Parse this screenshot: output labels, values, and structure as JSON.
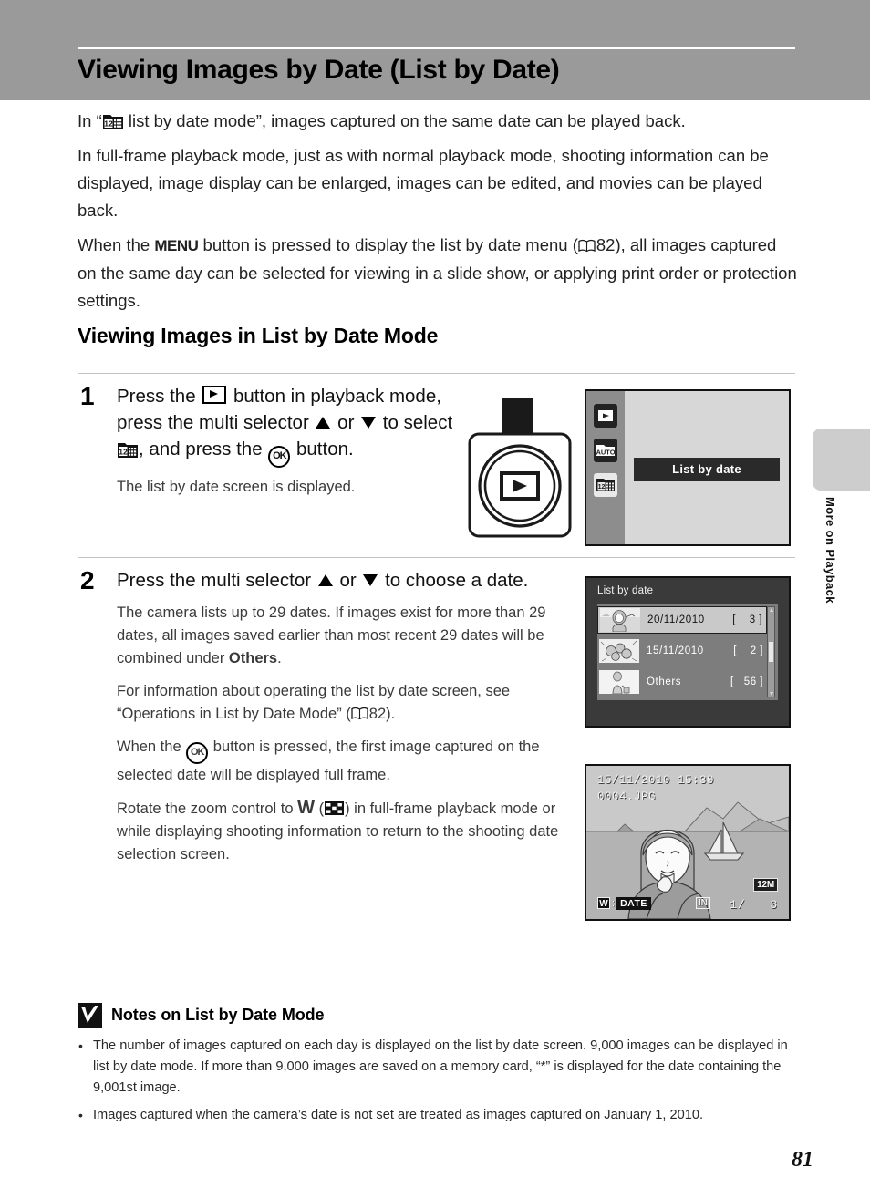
{
  "page": {
    "title": "Viewing Images by Date (List by Date)",
    "number": "81",
    "side_tab_label": "More on Playback",
    "header_color": "#9a9a9a"
  },
  "intro": {
    "p1_pre": "In “",
    "p1_post": " list by date mode”, images captured on the same date can be played back.",
    "p2": "In full-frame playback mode, just as with normal playback mode, shooting information can be displayed, image display can be enlarged, images can be edited, and movies can be played back.",
    "p3_a": "When the ",
    "p3_menu": "MENU",
    "p3_b": " button is pressed to display the list by date menu (",
    "p3_page": "82",
    "p3_c": "), all images captured on the same day can be selected for viewing in a slide show, or applying print order or protection settings."
  },
  "section": {
    "heading": "Viewing Images in List by Date Mode"
  },
  "steps": [
    {
      "number": "1",
      "lead_a": "Press the ",
      "lead_b": " button in playback mode, press the multi selector ",
      "lead_c": " or ",
      "lead_d": " to select ",
      "lead_e": ", and press the ",
      "lead_f": " button.",
      "sub1": "The list by date screen is displayed."
    },
    {
      "number": "2",
      "lead_a": "Press the multi selector ",
      "lead_b": " or ",
      "lead_c": " to choose a date.",
      "sub1_a": "The camera lists up to 29 dates. If images exist for more than 29 dates, all images saved earlier than most recent 29 dates will be combined under ",
      "sub1_bold": "Others",
      "sub1_b": ".",
      "sub2_a": "For information about operating the list by date screen, see “Operations in List by Date Mode” (",
      "sub2_page": "82",
      "sub2_b": ").",
      "sub3_a": "When the ",
      "sub3_b": " button is pressed, the first image captured on the selected date will be displayed full frame.",
      "sub4_a": "Rotate the zoom control to ",
      "sub4_w": "W",
      "sub4_b": " (",
      "sub4_c": ") in full-frame playback mode or while displaying shooting information to return to the shooting date selection screen."
    }
  ],
  "monitor_mode_select": {
    "selected_item": "List by date",
    "icons": [
      "playback-icon",
      "auto-mode-icon",
      "list-by-date-icon"
    ],
    "auto_label": "AUTO"
  },
  "monitor_list_by_date": {
    "title": "List by date",
    "rows": [
      {
        "date": "20/11/2010",
        "count": "[    3 ]",
        "selected": true
      },
      {
        "date": "15/11/2010",
        "count": "[    2 ]",
        "selected": false
      },
      {
        "date": "Others",
        "count": "[   56 ]",
        "selected": false
      }
    ]
  },
  "monitor_full_frame": {
    "datetime": "15/11/2010 15:30",
    "filename": "0004.JPG",
    "zoom_hint_key": "W",
    "zoom_hint_sep": ":",
    "zoom_hint_label": "DATE",
    "memory_indicator": "IN",
    "frame_counter": "1/   3",
    "image_size": "12M"
  },
  "notes": {
    "title": "Notes on List by Date Mode",
    "bullet": "•",
    "items": [
      "The number of images captured on each day is displayed on the list by date screen. 9,000 images can be displayed in list by date mode. If more than 9,000 images are saved on a memory card, “*” is displayed for the date containing the 9,001st image.",
      "Images captured when the camera’s date is not set are treated as images captured on January 1, 2010."
    ]
  }
}
